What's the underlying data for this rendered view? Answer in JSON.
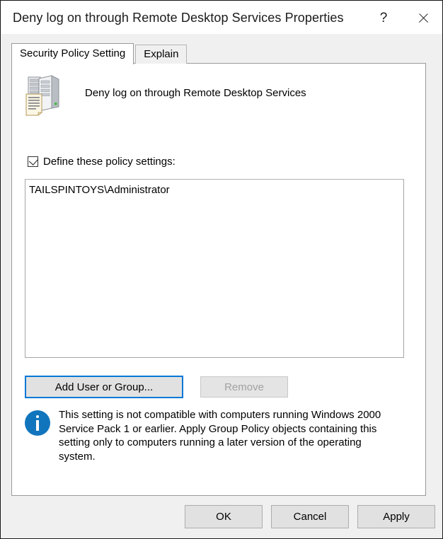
{
  "window": {
    "title": "Deny log on through Remote Desktop Services Properties",
    "help_label": "?",
    "close_label": "×"
  },
  "tabs": [
    {
      "label": "Security Policy Setting",
      "active": true
    },
    {
      "label": "Explain",
      "active": false
    }
  ],
  "policy": {
    "icon": "server-policy-icon",
    "name": "Deny log on through Remote Desktop Services"
  },
  "define_checkbox": {
    "label": "Define these policy settings:",
    "checked": true
  },
  "members_list": {
    "items": [
      "TAILSPINTOYS\\Administrator"
    ]
  },
  "actions": {
    "add_label": "Add User or Group...",
    "remove_label": "Remove",
    "remove_enabled": false,
    "focus_color": "#0078d7"
  },
  "info": {
    "icon": "info-icon",
    "icon_color": "#1175bd",
    "text": "This setting is not compatible with computers running Windows 2000 Service Pack 1 or earlier.  Apply Group Policy objects containing this setting only to computers running a later version of the operating system."
  },
  "footer": {
    "ok_label": "OK",
    "cancel_label": "Cancel",
    "apply_label": "Apply"
  }
}
